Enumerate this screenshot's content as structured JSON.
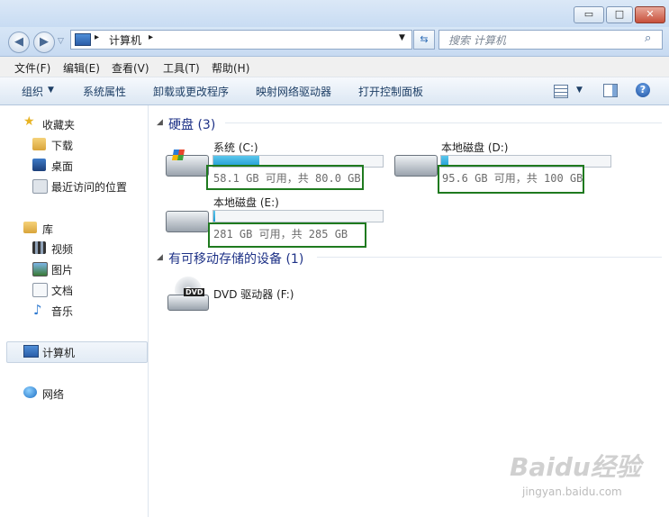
{
  "window": {
    "minimize": "▭",
    "maximize": "□",
    "close": "✕"
  },
  "nav": {
    "back": "◀",
    "forward": "▶",
    "address": "计算机",
    "address_sep": "▸",
    "search_placeholder": "搜索 计算机"
  },
  "menu": [
    "文件(F)",
    "编辑(E)",
    "查看(V)",
    "工具(T)",
    "帮助(H)"
  ],
  "commands": {
    "organize": "组织",
    "system_properties": "系统属性",
    "uninstall": "卸载或更改程序",
    "map_drive": "映射网络驱动器",
    "control_panel": "打开控制面板"
  },
  "sidebar": {
    "favorites": {
      "header": "收藏夹",
      "items": [
        "下载",
        "桌面",
        "最近访问的位置"
      ]
    },
    "libraries": {
      "header": "库",
      "items": [
        "视频",
        "图片",
        "文档",
        "音乐"
      ]
    },
    "computer": "计算机",
    "network": "网络"
  },
  "hard_disks": {
    "title": "硬盘 (3)",
    "drives": [
      {
        "name": "系统 (C:)",
        "free": "58.1 GB 可用，共 80.0 GB",
        "used_fraction": 0.27
      },
      {
        "name": "本地磁盘 (D:)",
        "free": "95.6 GB 可用，共 100 GB",
        "used_fraction": 0.04
      },
      {
        "name": "本地磁盘 (E:)",
        "free": "281 GB 可用，共 285 GB",
        "used_fraction": 0.014
      }
    ]
  },
  "removable": {
    "title": "有可移动存储的设备 (1)",
    "dvd_name": "DVD 驱动器 (F:)",
    "dvd_label": "DVD"
  },
  "watermark": {
    "brand": "Baidu经验",
    "url": "jingyan.baidu.com"
  },
  "colors": {
    "highlight_border": "#1f7a1f",
    "usage_fill": "#1f9bd4",
    "group_title": "#1e3287"
  }
}
